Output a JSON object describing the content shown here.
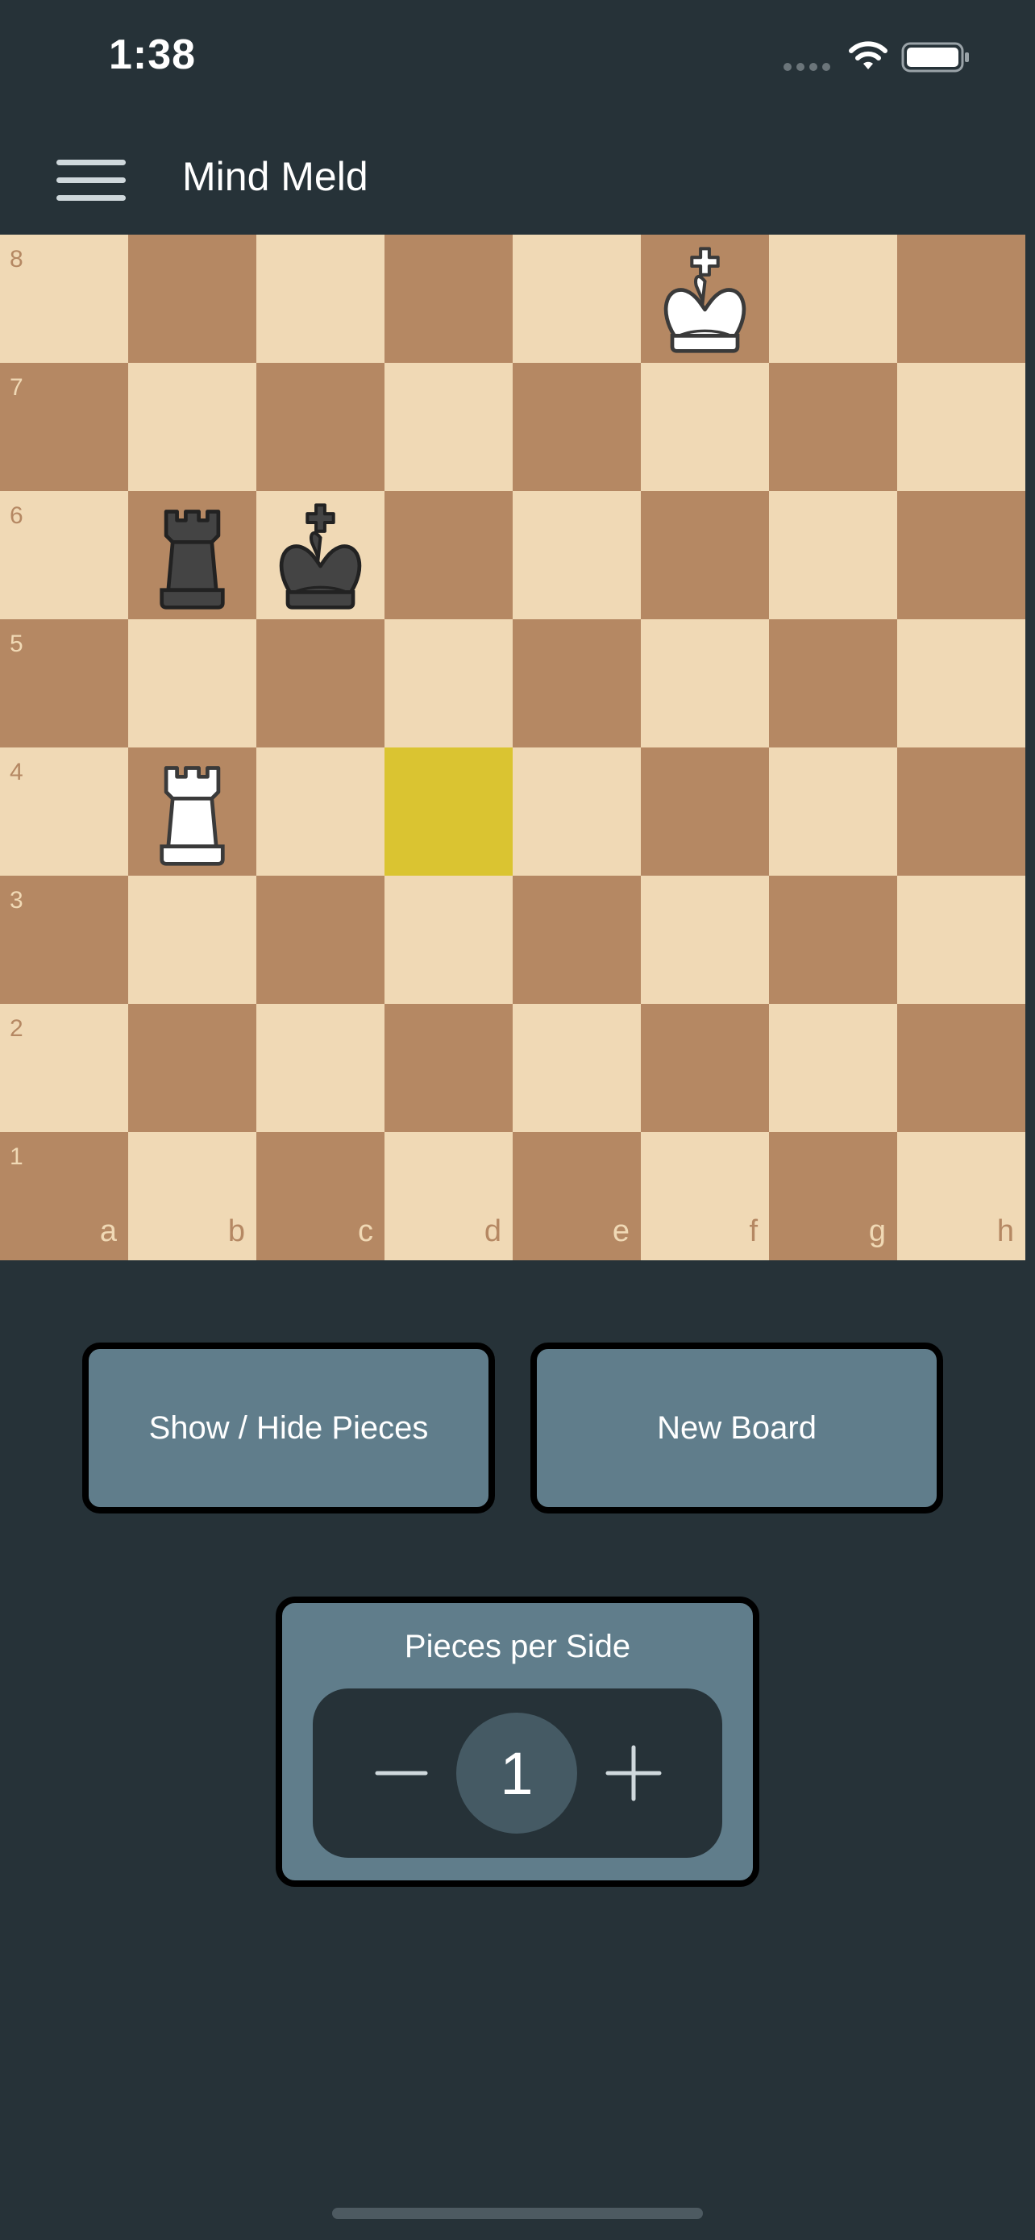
{
  "status_bar": {
    "time": "1:38"
  },
  "app_bar": {
    "title": "Mind Meld",
    "menu_icon": "hamburger-menu-icon"
  },
  "board": {
    "files": [
      "a",
      "b",
      "c",
      "d",
      "e",
      "f",
      "g",
      "h"
    ],
    "ranks": [
      "8",
      "7",
      "6",
      "5",
      "4",
      "3",
      "2",
      "1"
    ],
    "highlighted_square": "d4",
    "pieces": [
      {
        "square": "f8",
        "piece": "white-king-icon",
        "glyph": "♔"
      },
      {
        "square": "b6",
        "piece": "black-rook-icon",
        "glyph": "♜"
      },
      {
        "square": "c6",
        "piece": "black-king-icon",
        "glyph": "♚"
      },
      {
        "square": "b4",
        "piece": "white-rook-icon",
        "glyph": "♖"
      }
    ],
    "colors": {
      "light": "#f0d9b5",
      "dark": "#b58863",
      "highlight": "#dac431"
    }
  },
  "buttons": {
    "show_hide": "Show / Hide Pieces",
    "new_board": "New Board"
  },
  "pieces_per_side": {
    "label": "Pieces per Side",
    "value": "1",
    "minus_icon": "minus-icon",
    "plus_icon": "plus-icon"
  },
  "colors": {
    "background": "#263238",
    "button": "#607d8b",
    "stepper_bg": "#263238",
    "count_circle": "#455a64"
  }
}
